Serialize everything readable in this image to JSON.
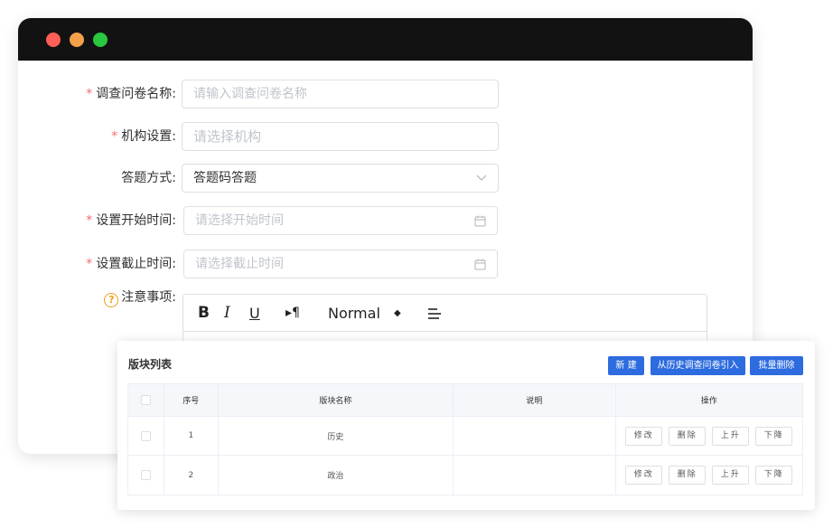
{
  "window": {
    "controls": [
      "close",
      "minimize",
      "maximize"
    ]
  },
  "form": {
    "survey_name": {
      "label": "调查问卷名称:",
      "required": true,
      "placeholder": "请输入调查问卷名称"
    },
    "org": {
      "label": "机构设置:",
      "required": true,
      "placeholder": "请选择机构"
    },
    "answer_mode": {
      "label": "答题方式:",
      "required": false,
      "value": "答题码答题"
    },
    "start_time": {
      "label": "设置开始时间:",
      "required": true,
      "placeholder": "请选择开始时间"
    },
    "end_time": {
      "label": "设置截止时间:",
      "required": true,
      "placeholder": "请选择截止时间"
    },
    "notes": {
      "label": "注意事项:",
      "help_icon": "?"
    }
  },
  "editor": {
    "bold": "B",
    "italic": "I",
    "underline": "U",
    "paragraph": "▸¶",
    "format_select": "Normal",
    "format_arrows": "◆"
  },
  "panel": {
    "title": "版块列表",
    "buttons": {
      "new": "新 建",
      "import": "从历史调查问卷引入",
      "batch_delete": "批量删除"
    },
    "columns": {
      "index": "序号",
      "name": "版块名称",
      "desc": "说明",
      "ops": "操作"
    },
    "rows": [
      {
        "index": "1",
        "name": "历史",
        "desc": ""
      },
      {
        "index": "2",
        "name": "政治",
        "desc": ""
      }
    ],
    "row_actions": {
      "edit": "修改",
      "delete": "删除",
      "up": "上升",
      "down": "下降"
    }
  },
  "colors": {
    "primary": "#2d6cdf",
    "required": "#f56c6c",
    "titlebar": "#121212"
  }
}
